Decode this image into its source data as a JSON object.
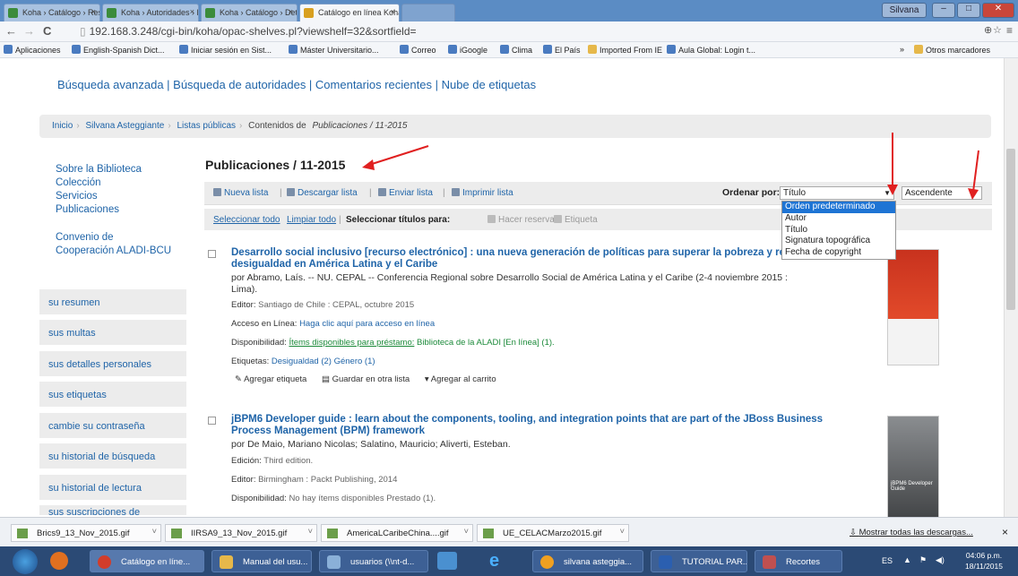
{
  "browser": {
    "tabs": [
      {
        "label": "Koha › Catálogo › Resulta",
        "active": false
      },
      {
        "label": "Koha › Autoridades › Deta",
        "active": false
      },
      {
        "label": "Koha › Catálogo › Detalles",
        "active": false
      },
      {
        "label": "Catálogo en línea Koha ›",
        "active": true
      }
    ],
    "user_badge": "Silvana",
    "url": "192.168.3.248/cgi-bin/koha/opac-shelves.pl?viewshelf=32&sortfield=",
    "bookmarks": [
      "Aplicaciones",
      "English-Spanish Dict...",
      "Iniciar sesión en Sist...",
      "Máster Universitario...",
      "Correo",
      "iGoogle",
      "Clima",
      "El País",
      "Imported From IE",
      "Aula Global: Login t..."
    ],
    "bookmarks_more": "»",
    "other_bookmarks": "Otros marcadores"
  },
  "page": {
    "top_links": "Búsqueda avanzada | Búsqueda de autoridades | Comentarios recientes | Nube de etiquetas",
    "breadcrumb": {
      "home": "Inicio",
      "user": "Silvana Asteggiante",
      "lists": "Listas públicas",
      "current_prefix": "Contenidos de ",
      "current_italic": "Publicaciones / 11-2015"
    },
    "left_nav": [
      "Sobre la Biblioteca",
      "Colección",
      "Servicios",
      "Publicaciones"
    ],
    "left_nav_2": [
      "Convenio de",
      "Cooperación ALADI-BCU"
    ],
    "user_menu": [
      "su resumen",
      "sus multas",
      "sus detalles personales",
      "sus etiquetas",
      "cambie su contraseña",
      "su historial de búsqueda",
      "su historial de lectura",
      "sus suscripciones de"
    ],
    "title": "Publicaciones / 11-2015",
    "toolbar": {
      "new_list": "Nueva lista",
      "download": "Descargar lista",
      "send": "Enviar lista",
      "print": "Imprimir lista",
      "sort_label": "Ordenar por:",
      "sort_value": "Título",
      "order_value": "Ascendente"
    },
    "select_bar": {
      "select_all": "Seleccionar todo",
      "clear_all": "Limpiar todo",
      "select_for": "Seleccionar títulos para:",
      "hold": "Hacer reserva",
      "tag": "Etiqueta"
    },
    "sort_options": [
      "Orden predeterminado",
      "Autor",
      "Título",
      "Signatura topográfica",
      "Fecha de copyright"
    ],
    "records": [
      {
        "title1": "Desarrollo social inclusivo [recurso electrónico] : una nueva generación de políticas para superar la pobreza y reducir la",
        "title2": "desigualdad en América Latina y el Caribe",
        "by": "por Abramo, Laís. -- NU. CEPAL -- Conferencia Regional sobre Desarrollo Social de América Latina y el Caribe (2-4 noviembre 2015 :",
        "by2": "Lima).",
        "editor_label": "Editor:",
        "editor": "Santiago de Chile : CEPAL, octubre 2015",
        "access_label": "Acceso en Línea:",
        "access": "Haga clic aquí para acceso en línea",
        "avail_label": "Disponibilidad:",
        "avail": "Ítems disponibles para préstamo:",
        "avail_detail": "Biblioteca de la ALADI [En línea] (1).",
        "tags_label": "Etiquetas:",
        "tags": "Desigualdad (2) Género (1)",
        "actions": [
          "Agregar etiqueta",
          "Guardar en otra lista",
          "Agregar al carrito"
        ]
      },
      {
        "title1": "jBPM6 Developer guide : learn about the components, tooling, and integration points that are part of the JBoss Business",
        "title2": "Process Management (BPM) framework",
        "by": "por De Maio, Mariano Nicolas; Salatino, Mauricio; Aliverti, Esteban.",
        "edition_label": "Edición:",
        "edition": "Third edition.",
        "editor_label": "Editor:",
        "editor": "Birmingham : Packt Publishing, 2014",
        "avail_label": "Disponibilidad:",
        "avail": "No hay ítems disponibles Prestado (1).",
        "cover_text": "jBPM6 Developer Guide"
      }
    ]
  },
  "downloads": {
    "items": [
      "Brics9_13_Nov_2015.gif",
      "IIRSA9_13_Nov_2015.gif",
      "AmericaLCaribeChina....gif",
      "UE_CELACMarzo2015.gif"
    ],
    "show_all": "Mostrar todas las descargas...",
    "close": "×"
  },
  "taskbar": {
    "items": [
      "Catálogo en líne...",
      "Manual del usu...",
      "usuarios (\\\\nt-d...",
      "silvana asteggia...",
      "TUTORIAL PAR...",
      "Recortes"
    ],
    "lang": "ES",
    "time": "04:06 p.m.",
    "date": "18/11/2015"
  },
  "colors": {
    "accent": "#1f64a8",
    "highlight": "#1e74d4",
    "annotation": "#e02020"
  }
}
